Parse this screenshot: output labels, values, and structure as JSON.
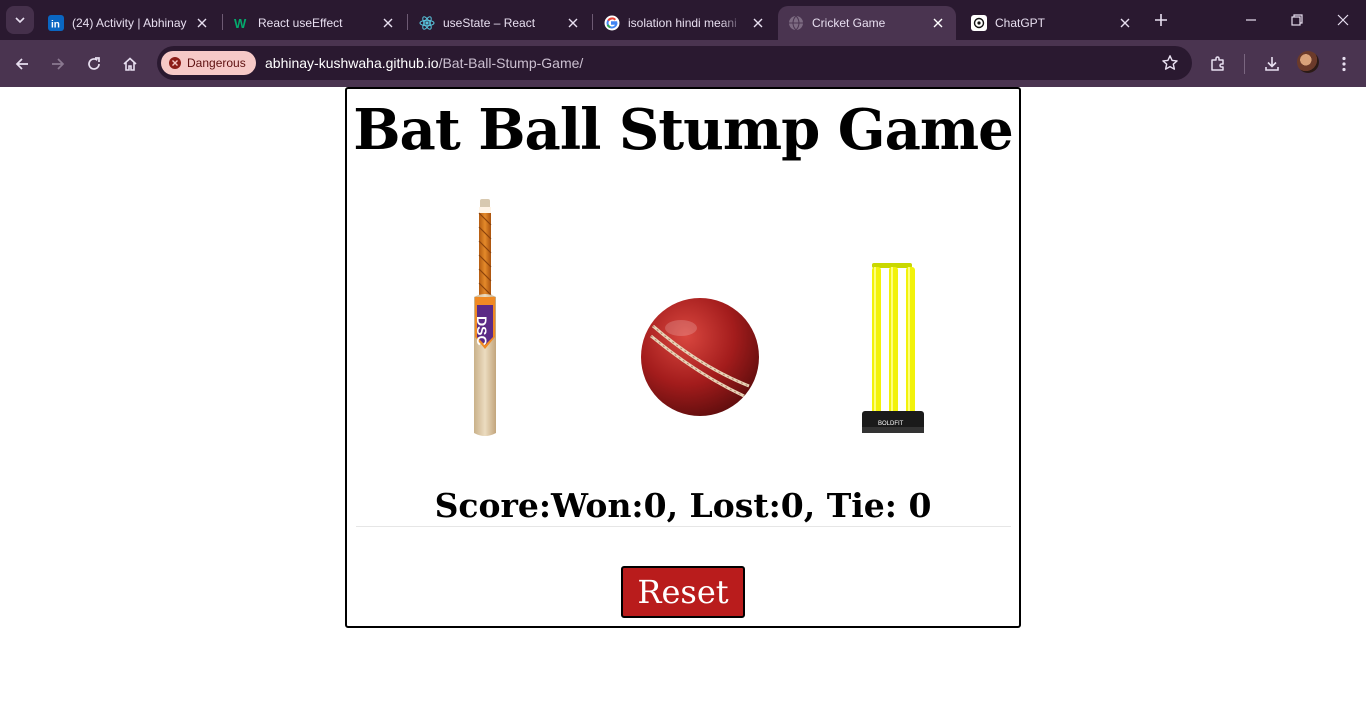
{
  "browser": {
    "tabs": [
      {
        "title": "(24) Activity | Abhinay",
        "icon": "linkedin-icon",
        "active": false
      },
      {
        "title": "React useEffect",
        "icon": "w3schools-icon",
        "active": false
      },
      {
        "title": "useState – React",
        "icon": "react-icon",
        "active": false
      },
      {
        "title": "isolation hindi meani",
        "icon": "google-icon",
        "active": false
      },
      {
        "title": "Cricket Game",
        "icon": "globe-icon",
        "active": true
      },
      {
        "title": "ChatGPT",
        "icon": "chatgpt-icon",
        "active": false
      }
    ],
    "security_chip": "Dangerous",
    "url_host": "abhinay-kushwaha.github.io",
    "url_path": "/Bat-Ball-Stump-Game/"
  },
  "game": {
    "title": "Bat Ball Stump Game",
    "choices": [
      "Bat",
      "Ball",
      "Stump"
    ],
    "score_text": "Score:Won:0, Lost:0, Tie: 0",
    "reset_label": "Reset"
  },
  "colors": {
    "tabstrip_bg": "#2a1930",
    "toolbar_bg": "#4a3450",
    "danger_chip": "#f6c9c7",
    "reset_button": "#b91c1c"
  }
}
